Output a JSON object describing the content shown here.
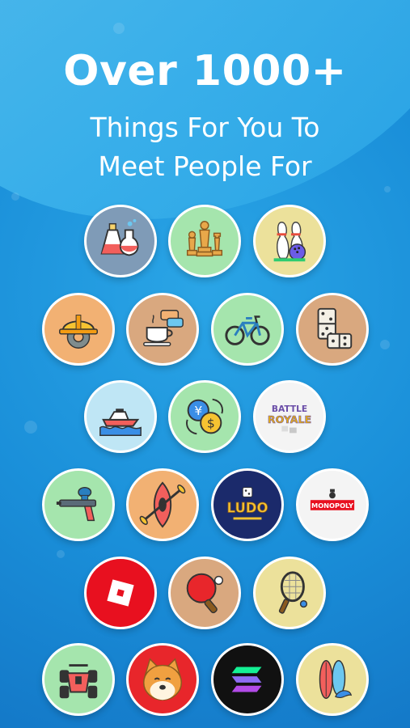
{
  "headline": {
    "title": "Over 1000+",
    "subtitle_line1": "Things For You To",
    "subtitle_line2": "Meet People For"
  },
  "activities": [
    {
      "icon": "chemistry-flasks-icon",
      "bg": "#7f9bb7"
    },
    {
      "icon": "chess-pieces-icon",
      "bg": "#a5e5ad"
    },
    {
      "icon": "bowling-icon",
      "bg": "#ece19b"
    },
    {
      "icon": "hard-hat-gear-icon",
      "bg": "#f2b173"
    },
    {
      "icon": "coffee-chat-icon",
      "bg": "#d9a87f"
    },
    {
      "icon": "bicycle-icon",
      "bg": "#a5e5ad"
    },
    {
      "icon": "domino-icon",
      "bg": "#d9a87f"
    },
    {
      "icon": "jet-ski-icon",
      "bg": "#bfe6f5"
    },
    {
      "icon": "currency-exchange-icon",
      "bg": "#a5e5ad"
    },
    {
      "icon": "fortnite-logo-icon",
      "bg": "#f4f4f4",
      "text1": "BATTLE",
      "text2": "ROYALE"
    },
    {
      "icon": "paintball-gun-icon",
      "bg": "#a5e5ad"
    },
    {
      "icon": "kayak-icon",
      "bg": "#f2b173"
    },
    {
      "icon": "ludo-logo-icon",
      "bg": "#1b2a6b",
      "text": "LUDO"
    },
    {
      "icon": "monopoly-logo-icon",
      "bg": "#f4f4f4",
      "text": "MONOPOLY"
    },
    {
      "icon": "roblox-logo-icon",
      "bg": "#e8101f"
    },
    {
      "icon": "ping-pong-icon",
      "bg": "#d9a87f"
    },
    {
      "icon": "racquetball-icon",
      "bg": "#ece19b"
    },
    {
      "icon": "atv-quad-icon",
      "bg": "#a5e5ad"
    },
    {
      "icon": "shiba-inu-icon",
      "bg": "#e8262b"
    },
    {
      "icon": "solana-logo-icon",
      "bg": "#111111"
    },
    {
      "icon": "surfboards-icon",
      "bg": "#ece19b"
    }
  ]
}
